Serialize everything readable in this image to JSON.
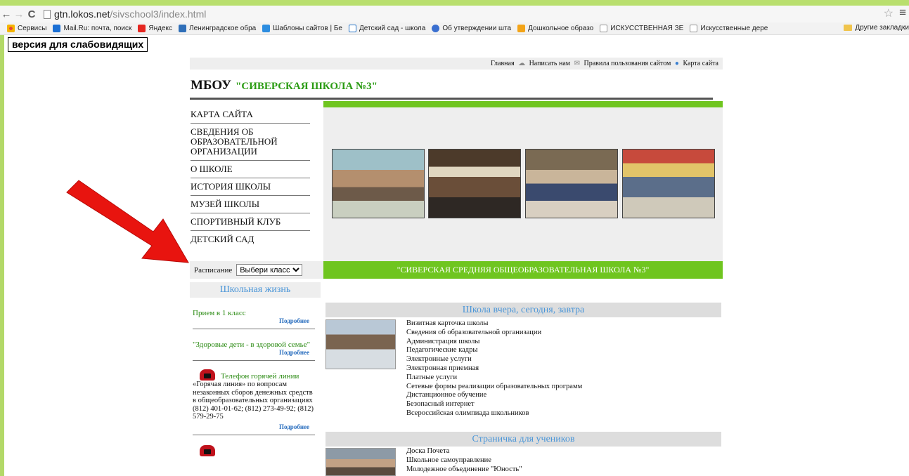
{
  "browser": {
    "url_host": "gtn.lokos.net",
    "url_path": "/sivschool3/index.html",
    "bookmarks": [
      {
        "label": "Сервисы",
        "color": "#e94335"
      },
      {
        "label": "Mail.Ru: почта, поиск",
        "color": "#1a6fd4"
      },
      {
        "label": "Яндекс",
        "color": "#e52620"
      },
      {
        "label": "Ленинградское обра",
        "color": "#2f6fb8"
      },
      {
        "label": "Шаблоны сайтов | Бе",
        "color": "#2d8de0"
      },
      {
        "label": "Детский сад - школа",
        "color": "#2b77c8"
      },
      {
        "label": "Об утверждении шта",
        "color": "#3a6fd0"
      },
      {
        "label": "Дошкольное образо",
        "color": "#f3a418"
      },
      {
        "label": "ИСКУССТВЕННАЯ ЗЕ",
        "color": "#9a9a9a"
      },
      {
        "label": "Искусственные дере",
        "color": "#9a9a9a"
      }
    ],
    "other_bookmarks": "Другие закладки"
  },
  "low_vision_button": "версия для слабовидящих",
  "top_links": {
    "home": "Главная",
    "write_us": "Написать нам",
    "rules": "Правила пользования сайтом",
    "sitemap": "Карта сайта"
  },
  "site_title": {
    "prefix": "МБОУ",
    "name": "\"СИВЕРСКАЯ ШКОЛА №3\""
  },
  "main_menu": [
    "КАРТА САЙТА",
    "СВЕДЕНИЯ ОБ ОБРАЗОВАТЕЛЬНОЙ ОРГАНИЗАЦИИ",
    "О ШКОЛЕ",
    "ИСТОРИЯ ШКОЛЫ",
    "МУЗЕЙ ШКОЛЫ",
    "СПОРТИВНЫЙ КЛУБ",
    "ДЕТСКИЙ САД"
  ],
  "schedule": {
    "label": "Расписание",
    "select_value": "Выбери класс"
  },
  "banner": "\"СИВЕРСКАЯ СРЕДНЯЯ ОБЩЕОБРАЗОВАТЕЛЬНАЯ ШКОЛА №3\"",
  "sidebar": {
    "heading": "Школьная жизнь",
    "more": "Подробнее",
    "news": [
      "Прием в 1 класс",
      "\"Здоровые дети - в здоровой семье\""
    ],
    "hotline": {
      "title": "Телефон горячей линии",
      "body": "«Горячая линия» по вопросам незаконных сборов денежных средств в общеобразовательных организациях",
      "phones": "(812) 401-01-62; (812) 273-49-92; (812) 579-29-75"
    }
  },
  "sections": [
    {
      "heading": "Школа вчера, сегодня, завтра",
      "links": [
        "Визитная карточка школы",
        "Сведения об образовательной организации",
        "Администрация школы",
        "Педагогические кадры",
        "Электронные услуги",
        "Электронная приемная",
        "Платные услуги",
        "Сетевые формы реализации образовательных программ",
        "Дистанционное обучение",
        "Безопасный интернет",
        "Всероссийская олимпиада школьников"
      ]
    },
    {
      "heading": "Страничка для учеников",
      "links": [
        "Доска Почета",
        "Школьное самоуправление",
        "Молодежное объединение \"Юность\""
      ]
    }
  ],
  "colors": {
    "accent_green": "#6fc51f",
    "title_green": "#2a9b12",
    "link_blue": "#4b96d8",
    "arrow_red": "#e8140f"
  }
}
